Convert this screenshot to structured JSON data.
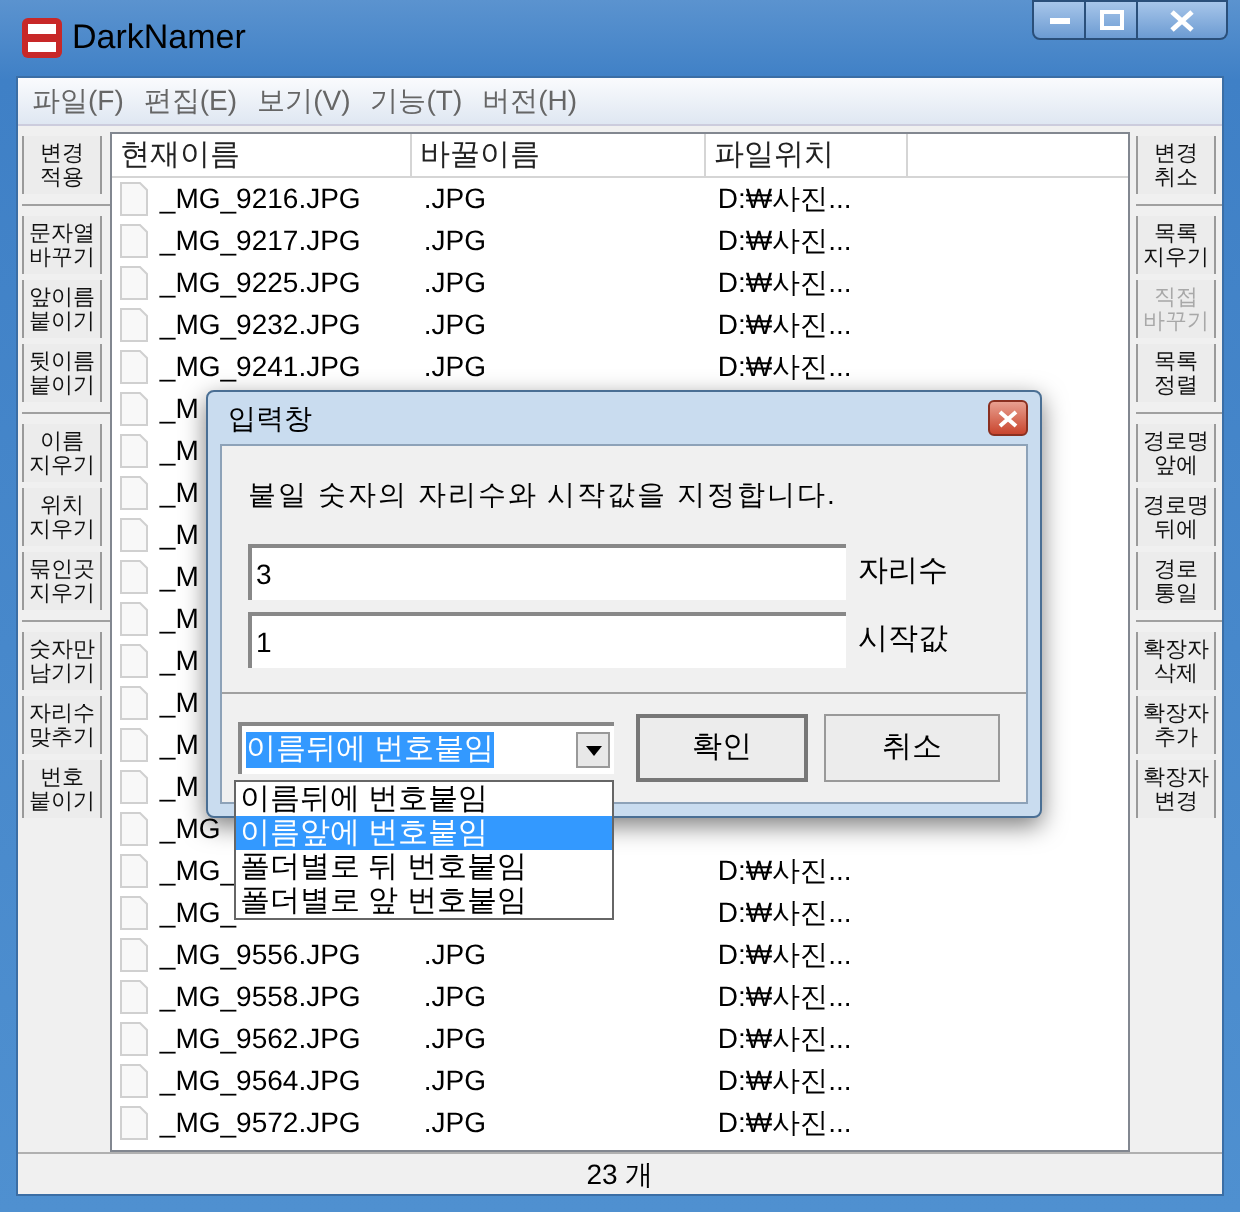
{
  "window": {
    "title": "DarkNamer"
  },
  "menu": [
    "파일(F)",
    "편집(E)",
    "보기(V)",
    "기능(T)",
    "버전(H)"
  ],
  "left_button_groups": [
    [
      {
        "lines": [
          "변경",
          "적용"
        ],
        "disabled": false
      }
    ],
    [
      {
        "lines": [
          "문자열",
          "바꾸기"
        ],
        "disabled": false
      },
      {
        "lines": [
          "앞이름",
          "붙이기"
        ],
        "disabled": false
      },
      {
        "lines": [
          "뒷이름",
          "붙이기"
        ],
        "disabled": false
      }
    ],
    [
      {
        "lines": [
          "이름",
          "지우기"
        ],
        "disabled": false
      },
      {
        "lines": [
          "위치",
          "지우기"
        ],
        "disabled": false
      },
      {
        "lines": [
          "묶인곳",
          "지우기"
        ],
        "disabled": false
      }
    ],
    [
      {
        "lines": [
          "숫자만",
          "남기기"
        ],
        "disabled": false
      },
      {
        "lines": [
          "자리수",
          "맞추기"
        ],
        "disabled": false
      },
      {
        "lines": [
          "번호",
          "붙이기"
        ],
        "disabled": false
      }
    ]
  ],
  "right_button_groups": [
    [
      {
        "lines": [
          "변경",
          "취소"
        ],
        "disabled": false
      }
    ],
    [
      {
        "lines": [
          "목록",
          "지우기"
        ],
        "disabled": false
      },
      {
        "lines": [
          "직접",
          "바꾸기"
        ],
        "disabled": true
      },
      {
        "lines": [
          "목록",
          "정렬"
        ],
        "disabled": false
      }
    ],
    [
      {
        "lines": [
          "경로명",
          "앞에"
        ],
        "disabled": false
      },
      {
        "lines": [
          "경로명",
          "뒤에"
        ],
        "disabled": false
      },
      {
        "lines": [
          "경로",
          "통일"
        ],
        "disabled": false
      }
    ],
    [
      {
        "lines": [
          "확장자",
          "삭제"
        ],
        "disabled": false
      },
      {
        "lines": [
          "확장자",
          "추가"
        ],
        "disabled": false
      },
      {
        "lines": [
          "확장자",
          "변경"
        ],
        "disabled": false
      }
    ]
  ],
  "table": {
    "columns": [
      "현재이름",
      "바꿀이름",
      "파일위치"
    ],
    "rows": [
      {
        "name": "_MG_9216.JPG",
        "new_name": ".JPG",
        "location": "D:₩사진..."
      },
      {
        "name": "_MG_9217.JPG",
        "new_name": ".JPG",
        "location": "D:₩사진..."
      },
      {
        "name": "_MG_9225.JPG",
        "new_name": ".JPG",
        "location": "D:₩사진..."
      },
      {
        "name": "_MG_9232.JPG",
        "new_name": ".JPG",
        "location": "D:₩사진..."
      },
      {
        "name": "_MG_9241.JPG",
        "new_name": ".JPG",
        "location": "D:₩사진..."
      },
      {
        "name": "_M"
      },
      {
        "name": "_M"
      },
      {
        "name": "_M"
      },
      {
        "name": "_M"
      },
      {
        "name": "_M"
      },
      {
        "name": "_M"
      },
      {
        "name": "_M"
      },
      {
        "name": "_M"
      },
      {
        "name": "_M"
      },
      {
        "name": "_M"
      },
      {
        "name": "_MG"
      },
      {
        "name": "_MG_",
        "location": "D:₩사진..."
      },
      {
        "name": "_MG_",
        "location": "D:₩사진..."
      },
      {
        "name": "_MG_9556.JPG",
        "new_name": ".JPG",
        "location": "D:₩사진..."
      },
      {
        "name": "_MG_9558.JPG",
        "new_name": ".JPG",
        "location": "D:₩사진..."
      },
      {
        "name": "_MG_9562.JPG",
        "new_name": ".JPG",
        "location": "D:₩사진..."
      },
      {
        "name": "_MG_9564.JPG",
        "new_name": ".JPG",
        "location": "D:₩사진..."
      },
      {
        "name": "_MG_9572.JPG",
        "new_name": ".JPG",
        "location": "D:₩사진..."
      }
    ]
  },
  "status_bar": "23 개",
  "dialog": {
    "title": "입력창",
    "message": "붙일 숫자의 자리수와 시작값을 지정합니다.",
    "fields": [
      {
        "value": "3",
        "label": "자리수"
      },
      {
        "value": "1",
        "label": "시작값"
      }
    ],
    "combo": {
      "value": "이름뒤에 번호붙임",
      "options": [
        {
          "label": "이름뒤에 번호붙임",
          "highlighted": false
        },
        {
          "label": "이름앞에 번호붙임",
          "highlighted": true
        },
        {
          "label": "폴더별로 뒤 번호붙임",
          "highlighted": false
        },
        {
          "label": "폴더별로 앞 번호붙임",
          "highlighted": false
        }
      ]
    },
    "buttons": [
      "확인",
      "취소"
    ]
  }
}
